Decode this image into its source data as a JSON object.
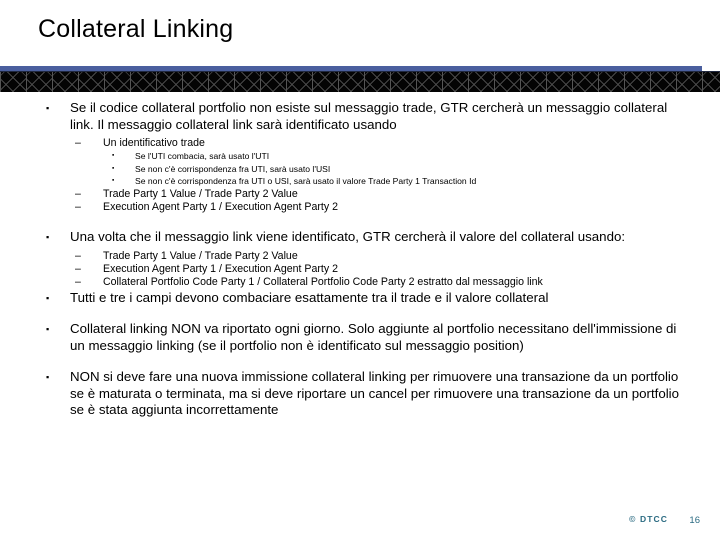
{
  "slide": {
    "title": "Collateral Linking",
    "page_number": "16",
    "logo_text": "© DTCC",
    "accent_blue": "#4a5f9e",
    "band_black": "#040404",
    "footer_color": "#2b6b82"
  },
  "markers": {
    "level1": "▪",
    "level2": "–",
    "level3": "▪"
  },
  "body": {
    "b1": "Se il codice collateral portfolio non esiste sul messaggio trade, GTR cercherà un messaggio collateral link. Il messaggio collateral link sarà identificato usando",
    "b1_s1": "Un identificativo trade",
    "b1_s1_t1": "Se l'UTI combacia, sarà usato l'UTI",
    "b1_s1_t2": "Se non c'è corrispondenza fra UTI, sarà usato l'USI",
    "b1_s1_t3": "Se non c'è corrispondenza fra UTI o USI, sarà usato il valore Trade Party 1 Transaction Id",
    "b1_s2": "Trade Party 1 Value / Trade Party 2 Value",
    "b1_s3": "Execution Agent Party 1 / Execution Agent Party 2",
    "b2": "Una volta che il messaggio link viene identificato, GTR cercherà il valore del collateral usando:",
    "b2_s1": "Trade Party 1 Value / Trade Party 2 Value",
    "b2_s2": "Execution Agent Party 1 / Execution Agent Party 2",
    "b2_s3": "Collateral Portfolio Code Party 1 / Collateral Portfolio Code Party 2 estratto dal messaggio link",
    "b3": "Tutti e tre i campi devono combaciare esattamente tra il trade e il valore collateral",
    "b4": "Collateral linking NON va riportato ogni giorno. Solo aggiunte al portfolio necessitano dell'immissione di un messaggio linking (se il portfolio non è identificato sul messaggio position)",
    "b5": "NON si deve fare una nuova immissione collateral linking per rimuovere una transazione da un portfolio se è maturata o terminata, ma si deve riportare un cancel per rimuovere una transazione da un portfolio se è stata aggiunta incorrettamente"
  }
}
